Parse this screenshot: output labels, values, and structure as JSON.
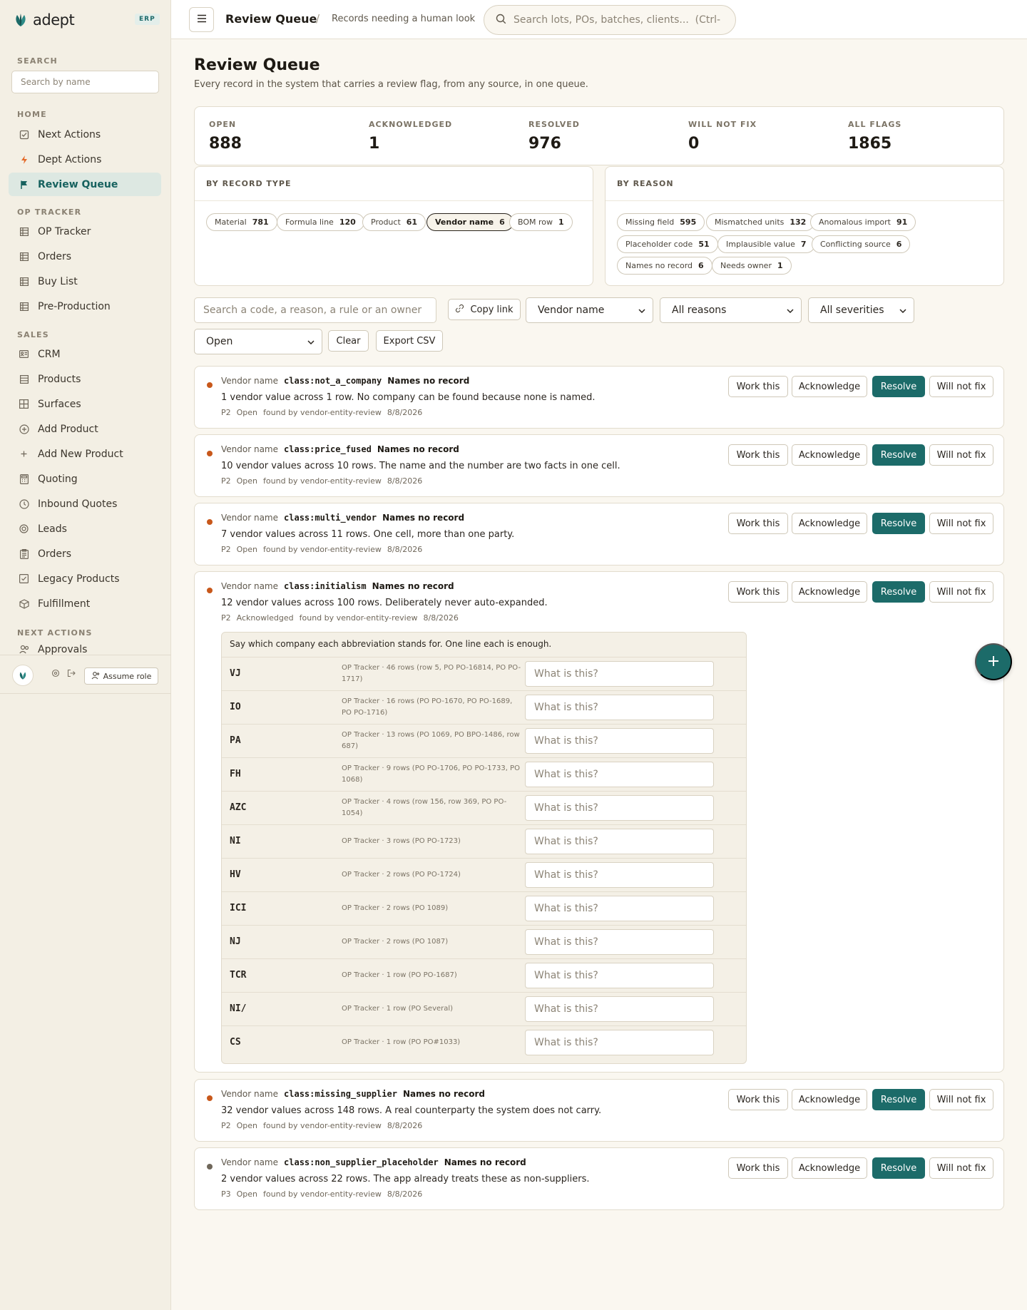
{
  "brand": {
    "name": "adept",
    "badge": "ERP"
  },
  "sidebar": {
    "search_label": "SEARCH",
    "search_placeholder": "Search by name",
    "sections": {
      "home": "HOME",
      "op_tracker": "OP TRACKER",
      "sales": "SALES",
      "next_actions": "NEXT ACTIONS"
    },
    "items": [
      {
        "label": "Next Actions",
        "icon": "checkbox-icon"
      },
      {
        "label": "Dept Actions",
        "icon": "lightning-icon"
      },
      {
        "label": "Review Queue",
        "icon": "flag-icon",
        "active": true
      },
      {
        "label": "OP Tracker",
        "icon": "grid-icon"
      },
      {
        "label": "Orders",
        "icon": "grid-icon"
      },
      {
        "label": "Buy List",
        "icon": "grid-icon"
      },
      {
        "label": "Pre-Production",
        "icon": "grid-icon"
      },
      {
        "label": "CRM",
        "icon": "contacts-icon"
      },
      {
        "label": "Products",
        "icon": "list-icon"
      },
      {
        "label": "Surfaces",
        "icon": "layout-icon"
      },
      {
        "label": "Add Product",
        "icon": "plus-circle-icon"
      },
      {
        "label": "Add New Product",
        "icon": "plus-icon"
      },
      {
        "label": "Quoting",
        "icon": "calculator-icon"
      },
      {
        "label": "Inbound Quotes",
        "icon": "clock-icon"
      },
      {
        "label": "Leads",
        "icon": "target-icon"
      },
      {
        "label": "Orders",
        "icon": "clipboard-icon"
      },
      {
        "label": "Legacy Products",
        "icon": "check-square-icon"
      },
      {
        "label": "Fulfillment",
        "icon": "package-icon"
      },
      {
        "label": "Approvals",
        "icon": "users-icon"
      }
    ],
    "assume_role": "Assume role"
  },
  "topbar": {
    "title": "Review Queue",
    "separator": "/",
    "subtitle": "Records needing a human look",
    "search_placeholder": "Search lots, POs, batches, clients...  (Ctrl-K)"
  },
  "page": {
    "title": "Review Queue",
    "subtitle": "Every record in the system that carries a review flag, from any source, in one queue."
  },
  "stats": [
    {
      "label": "OPEN",
      "value": "888"
    },
    {
      "label": "ACKNOWLEDGED",
      "value": "1"
    },
    {
      "label": "RESOLVED",
      "value": "976"
    },
    {
      "label": "WILL NOT FIX",
      "value": "0"
    },
    {
      "label": "ALL FLAGS",
      "value": "1865"
    }
  ],
  "by_record_type": {
    "title": "BY RECORD TYPE",
    "chips": [
      {
        "label": "Material",
        "count": "781"
      },
      {
        "label": "Formula line",
        "count": "120"
      },
      {
        "label": "Product",
        "count": "61"
      },
      {
        "label": "Vendor name",
        "count": "6",
        "selected": true
      },
      {
        "label": "BOM row",
        "count": "1"
      }
    ]
  },
  "by_reason": {
    "title": "BY REASON",
    "chips": [
      {
        "label": "Missing field",
        "count": "595"
      },
      {
        "label": "Mismatched units",
        "count": "132"
      },
      {
        "label": "Anomalous import",
        "count": "91"
      },
      {
        "label": "Placeholder code",
        "count": "51"
      },
      {
        "label": "Implausible value",
        "count": "7"
      },
      {
        "label": "Conflicting source",
        "count": "6"
      },
      {
        "label": "Names no record",
        "count": "6"
      },
      {
        "label": "Needs owner",
        "count": "1"
      }
    ]
  },
  "filters": {
    "search_placeholder": "Search a code, a reason, a rule or an owner",
    "copy_link": "Copy link",
    "record_type": "Vendor name",
    "reason": "All reasons",
    "severity": "All severities",
    "status": "Open",
    "clear": "Clear",
    "export": "Export CSV"
  },
  "actions": {
    "work": "Work this",
    "acknowledge": "Acknowledge",
    "resolve": "Resolve",
    "will_not_fix": "Will not fix"
  },
  "colors": {
    "accent": "#1c6b69",
    "dot_p2": "#c8581b",
    "dot_p3": "#6f675a"
  },
  "cards": [
    {
      "type": "Vendor name",
      "class": "class:not_a_company",
      "reason": "Names no record",
      "desc": "1 vendor value across 1 row. No company can be found because none is named.",
      "priority": "P2",
      "status": "Open",
      "found_by": "found by vendor-entity-review",
      "date": "8/8/2026"
    },
    {
      "type": "Vendor name",
      "class": "class:price_fused",
      "reason": "Names no record",
      "desc": "10 vendor values across 10 rows. The name and the number are two facts in one cell.",
      "priority": "P2",
      "status": "Open",
      "found_by": "found by vendor-entity-review",
      "date": "8/8/2026"
    },
    {
      "type": "Vendor name",
      "class": "class:multi_vendor",
      "reason": "Names no record",
      "desc": "7 vendor values across 11 rows. One cell, more than one party.",
      "priority": "P2",
      "status": "Open",
      "found_by": "found by vendor-entity-review",
      "date": "8/8/2026"
    },
    {
      "type": "Vendor name",
      "class": "class:initialism",
      "reason": "Names no record",
      "desc": "12 vendor values across 100 rows. Deliberately never auto-expanded.",
      "priority": "P2",
      "status": "Acknowledged",
      "found_by": "found by vendor-entity-review",
      "date": "8/8/2026"
    },
    {
      "type": "Vendor name",
      "class": "class:missing_supplier",
      "reason": "Names no record",
      "desc": "32 vendor values across 148 rows. A real counterparty the system does not carry.",
      "priority": "P2",
      "status": "Open",
      "found_by": "found by vendor-entity-review",
      "date": "8/8/2026"
    },
    {
      "type": "Vendor name",
      "class": "class:non_supplier_placeholder",
      "reason": "Names no record",
      "desc": "2 vendor values across 22 rows. The app already treats these as non-suppliers.",
      "priority": "P3",
      "status": "Open",
      "found_by": "found by vendor-entity-review",
      "date": "8/8/2026"
    }
  ],
  "abbreviations": {
    "instruction": "Say which company each abbreviation stands for. One line each is enough.",
    "input_placeholder": "What is this?",
    "rows": [
      {
        "code": "VJ",
        "source": "OP Tracker · 46 rows (row 5, PO PO-16814, PO PO-1717)"
      },
      {
        "code": "IO",
        "source": "OP Tracker · 16 rows (PO PO-1670, PO PO-1689, PO PO-1716)"
      },
      {
        "code": "PA",
        "source": "OP Tracker · 13 rows (PO 1069, PO BPO-1486, row 687)"
      },
      {
        "code": "FH",
        "source": "OP Tracker · 9 rows (PO PO-1706, PO PO-1733, PO 1068)"
      },
      {
        "code": "AZC",
        "source": "OP Tracker · 4 rows (row 156, row 369, PO PO-1054)"
      },
      {
        "code": "NI",
        "source": "OP Tracker · 3 rows (PO PO-1723)"
      },
      {
        "code": "HV",
        "source": "OP Tracker · 2 rows (PO PO-1724)"
      },
      {
        "code": "ICI",
        "source": "OP Tracker · 2 rows (PO 1089)"
      },
      {
        "code": "NJ",
        "source": "OP Tracker · 2 rows (PO 1087)"
      },
      {
        "code": "TCR",
        "source": "OP Tracker · 1 row (PO PO-1687)"
      },
      {
        "code": "NI/",
        "source": "OP Tracker · 1 row (PO Several)"
      },
      {
        "code": "CS",
        "source": "OP Tracker · 1 row (PO PO#1033)"
      }
    ]
  }
}
